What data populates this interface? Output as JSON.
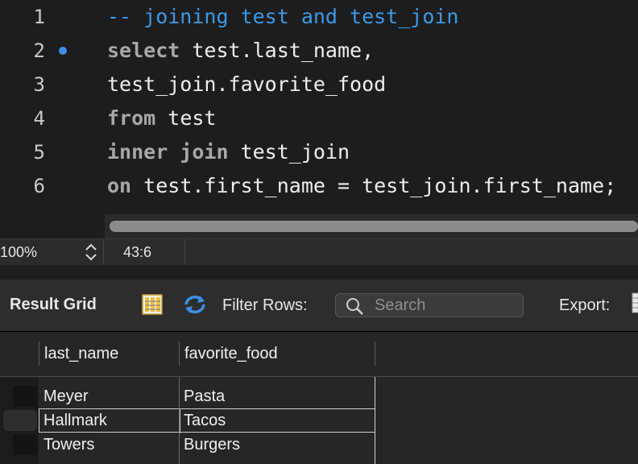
{
  "editor": {
    "lines": [
      {
        "num": "1",
        "parts": [
          {
            "t": "-- joining test and test_join",
            "c": "cm"
          }
        ]
      },
      {
        "num": "2",
        "parts": [
          {
            "t": "select",
            "c": "kw"
          },
          {
            "t": " test.last_name,",
            "c": ""
          }
        ]
      },
      {
        "num": "3",
        "parts": [
          {
            "t": "test_join.favorite_food",
            "c": ""
          }
        ]
      },
      {
        "num": "4",
        "parts": [
          {
            "t": "from",
            "c": "kw"
          },
          {
            "t": " test",
            "c": ""
          }
        ]
      },
      {
        "num": "5",
        "parts": [
          {
            "t": "inner join",
            "c": "kw"
          },
          {
            "t": " test_join",
            "c": ""
          }
        ]
      },
      {
        "num": "6",
        "parts": [
          {
            "t": "on",
            "c": "kw"
          },
          {
            "t": " test.first_name = test_join.first_name;",
            "c": ""
          }
        ]
      }
    ]
  },
  "status": {
    "zoom": "100%",
    "cursor": "43:6"
  },
  "toolbar": {
    "title": "Result Grid",
    "filter_label": "Filter Rows:",
    "search_placeholder": "Search",
    "export_label": "Export:"
  },
  "grid": {
    "columns": [
      "last_name",
      "favorite_food"
    ],
    "rows": [
      [
        "Meyer",
        "Pasta"
      ],
      [
        "Hallmark",
        "Tacos"
      ],
      [
        "Towers",
        "Burgers"
      ]
    ]
  },
  "colors": {
    "keyword": "#a8a8a8",
    "comment": "#3b9ae6",
    "marker": "#3d8fe6"
  }
}
